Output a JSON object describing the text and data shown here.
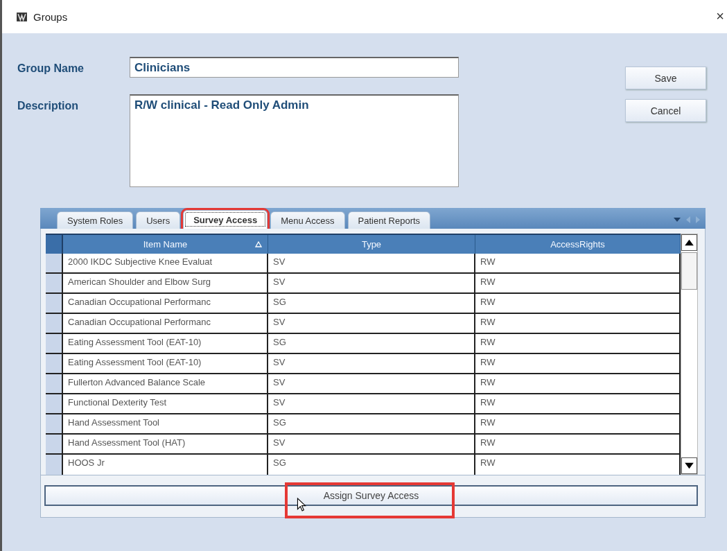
{
  "window": {
    "title": "Groups",
    "close": "×"
  },
  "form": {
    "group_name_label": "Group Name",
    "group_name": "Clinicians",
    "description_label": "Description",
    "description": "R/W clinical - Read Only Admin"
  },
  "buttons": [
    {
      "label": "Save"
    },
    {
      "label": "Cancel"
    }
  ],
  "tabs": [
    {
      "label": "System Roles",
      "selected": false,
      "highlighted": false
    },
    {
      "label": "Users",
      "selected": false,
      "highlighted": false
    },
    {
      "label": "Survey Access",
      "selected": true,
      "highlighted": true
    },
    {
      "label": "Menu Access",
      "selected": false,
      "highlighted": false
    },
    {
      "label": "Patient Reports",
      "selected": false,
      "highlighted": false
    }
  ],
  "table": {
    "columns": [
      "Item Name",
      "Type",
      "AccessRights"
    ],
    "rows": [
      [
        "2000 IKDC Subjective Knee Evaluat",
        "SV",
        "RW"
      ],
      [
        "American Shoulder and Elbow Surg",
        "SV",
        "RW"
      ],
      [
        "Canadian Occupational Performanc",
        "SG",
        "RW"
      ],
      [
        "Canadian Occupational Performanc",
        "SV",
        "RW"
      ],
      [
        "Eating Assessment Tool (EAT-10)",
        "SG",
        "RW"
      ],
      [
        "Eating Assessment Tool (EAT-10)",
        "SV",
        "RW"
      ],
      [
        "Fullerton Advanced Balance Scale",
        "SV",
        "RW"
      ],
      [
        "Functional Dexterity Test",
        "SV",
        "RW"
      ],
      [
        "Hand Assessment Tool",
        "SG",
        "RW"
      ],
      [
        "Hand Assessment Tool (HAT)",
        "SV",
        "RW"
      ],
      [
        "HOOS Jr",
        "SG",
        "RW"
      ]
    ]
  },
  "assign_button": {
    "label": "Assign Survey Access",
    "highlighted": true
  }
}
